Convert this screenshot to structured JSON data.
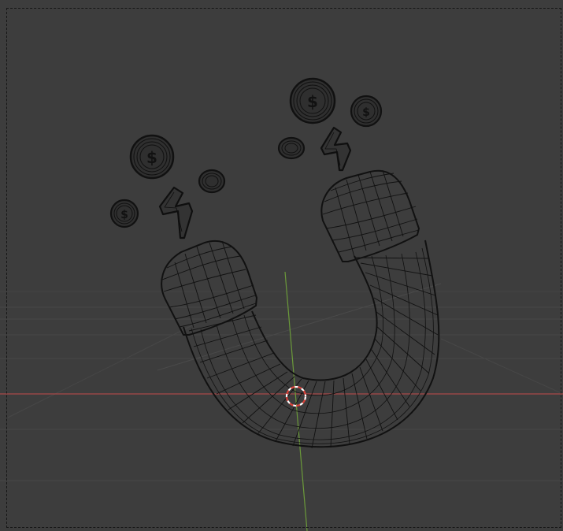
{
  "viewport": {
    "mode": "wireframe",
    "view": "perspective",
    "background": "#3d3d3d",
    "wire_color": "#0f0f0f",
    "axis_x_color": "#b44a4a",
    "axis_y_color": "#6a9a3a",
    "cursor_colors": [
      "#ffffff",
      "#d9423a"
    ]
  },
  "scene": {
    "objects": [
      {
        "name": "magnet",
        "icon": "magnet-icon"
      },
      {
        "name": "coin",
        "icon": "dollar-coin-icon",
        "count": 6
      },
      {
        "name": "lightning",
        "icon": "lightning-bolt-icon",
        "count": 2
      }
    ]
  }
}
